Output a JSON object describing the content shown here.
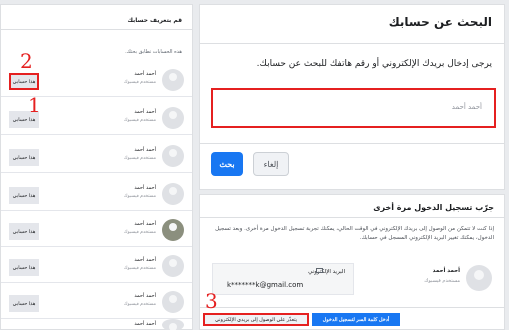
{
  "search": {
    "title": "البحث عن حسابك",
    "instructions": "يرجى إدخال بريدك الإلكتروني أو رقم هاتفك للبحث عن حسابك.",
    "placeholder": "أحمد أحمد",
    "search_label": "بحث",
    "cancel_label": "إلغاء",
    "marker": "1"
  },
  "retry": {
    "title": "جرّب تسجيل الدخول مرة أخرى",
    "body": "إذا كنت لا تتمكن من الوصول إلى بريدك الإلكتروني في الوقت الحالي، يمكنك تجربة تسجيل الدخول مرة أخرى. وبعد تسجيل الدخول، يمكنك تغيير البريد الإلكتروني المسجل في حسابك.",
    "name": "أحمد أحمد",
    "sub": "مستخدم فيسبوك",
    "email_label": "البريد الإلكتروني",
    "email_value": "k*******k@gmail.com",
    "email_login_label": "يتعذّر علي الوصول إلى بريدي الإلكتروني",
    "password_login_label": "أدخل كلمة السر لتسجيل الدخول",
    "marker": "3"
  },
  "list": {
    "title": "قم بتعريف حسابك",
    "subtitle": "هذه الحسابات تطابق بحثك.",
    "marker": "2",
    "rows": [
      {
        "name": "أحمد أحمد",
        "sub": "مستخدم فيسبوك",
        "button": "هذا حسابي"
      },
      {
        "name": "أحمد أحمد",
        "sub": "مستخدم فيسبوك",
        "button": "هذا حسابي"
      },
      {
        "name": "أحمد أحمد",
        "sub": "مستخدم فيسبوك",
        "button": "هذا حسابي"
      },
      {
        "name": "أحمد أحمد",
        "sub": "مستخدم فيسبوك",
        "button": "هذا حسابي"
      },
      {
        "name": "أحمد أحمد",
        "sub": "مستخدم فيسبوك",
        "button": "هذا حسابي"
      },
      {
        "name": "أحمد أحمد",
        "sub": "مستخدم فيسبوك",
        "button": "هذا حسابي"
      },
      {
        "name": "أحمد أحمد",
        "sub": "مستخدم فيسبوك",
        "button": "هذا حسابي"
      },
      {
        "name": "أحمد أحمد",
        "sub": "مستخدم فيسبوك",
        "button": "هذا حسابي"
      }
    ]
  }
}
